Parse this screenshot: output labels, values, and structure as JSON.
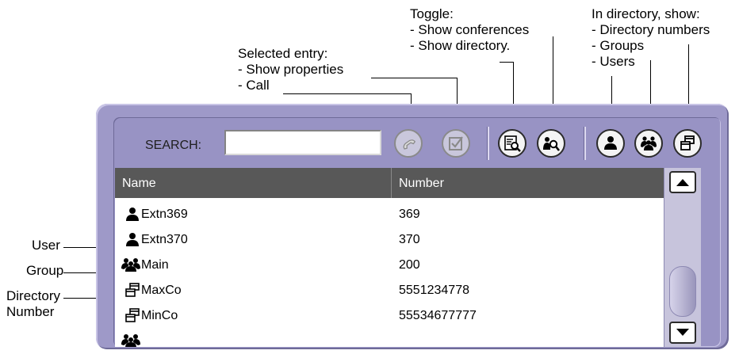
{
  "annotations": {
    "selected_entry": [
      "Selected entry:",
      "- Show properties",
      "- Call"
    ],
    "toggle": [
      "Toggle:",
      "- Show conferences",
      "- Show directory."
    ],
    "in_directory": [
      "In directory, show:",
      "- Directory numbers",
      "- Groups",
      "- Users"
    ],
    "left": {
      "user": "User",
      "group": "Group",
      "directory_number": [
        "Directory",
        "Number"
      ]
    }
  },
  "search": {
    "label": "SEARCH:",
    "value": ""
  },
  "toolbar": {
    "buttons": [
      {
        "name": "call",
        "icon": "phone-icon",
        "enabled": false
      },
      {
        "name": "show-properties",
        "icon": "checkbox-icon",
        "enabled": false
      },
      {
        "name": "show-conferences",
        "icon": "conference-search-icon",
        "enabled": true
      },
      {
        "name": "show-directory",
        "icon": "directory-search-icon",
        "enabled": true
      },
      {
        "name": "show-users",
        "icon": "user-icon",
        "enabled": true
      },
      {
        "name": "show-groups",
        "icon": "group-icon",
        "enabled": true
      },
      {
        "name": "show-directory-numbers",
        "icon": "directory-number-icon",
        "enabled": true
      }
    ]
  },
  "table": {
    "columns": [
      "Name",
      "Number"
    ],
    "rows": [
      {
        "type": "user",
        "icon": "user-icon",
        "name": "Extn369",
        "number": "369"
      },
      {
        "type": "user",
        "icon": "user-icon",
        "name": "Extn370",
        "number": "370"
      },
      {
        "type": "group",
        "icon": "group-icon",
        "name": "Main",
        "number": "200"
      },
      {
        "type": "directory",
        "icon": "directory-number-icon",
        "name": "MaxCo",
        "number": "5551234778"
      },
      {
        "type": "directory",
        "icon": "directory-number-icon",
        "name": "MinCo",
        "number": "55534677777"
      },
      {
        "type": "group",
        "icon": "group-icon",
        "name": "",
        "number": ""
      }
    ]
  },
  "colors": {
    "panel": "#9e99c8",
    "header": "#585858",
    "scrollbar": "#c7c4dc"
  }
}
